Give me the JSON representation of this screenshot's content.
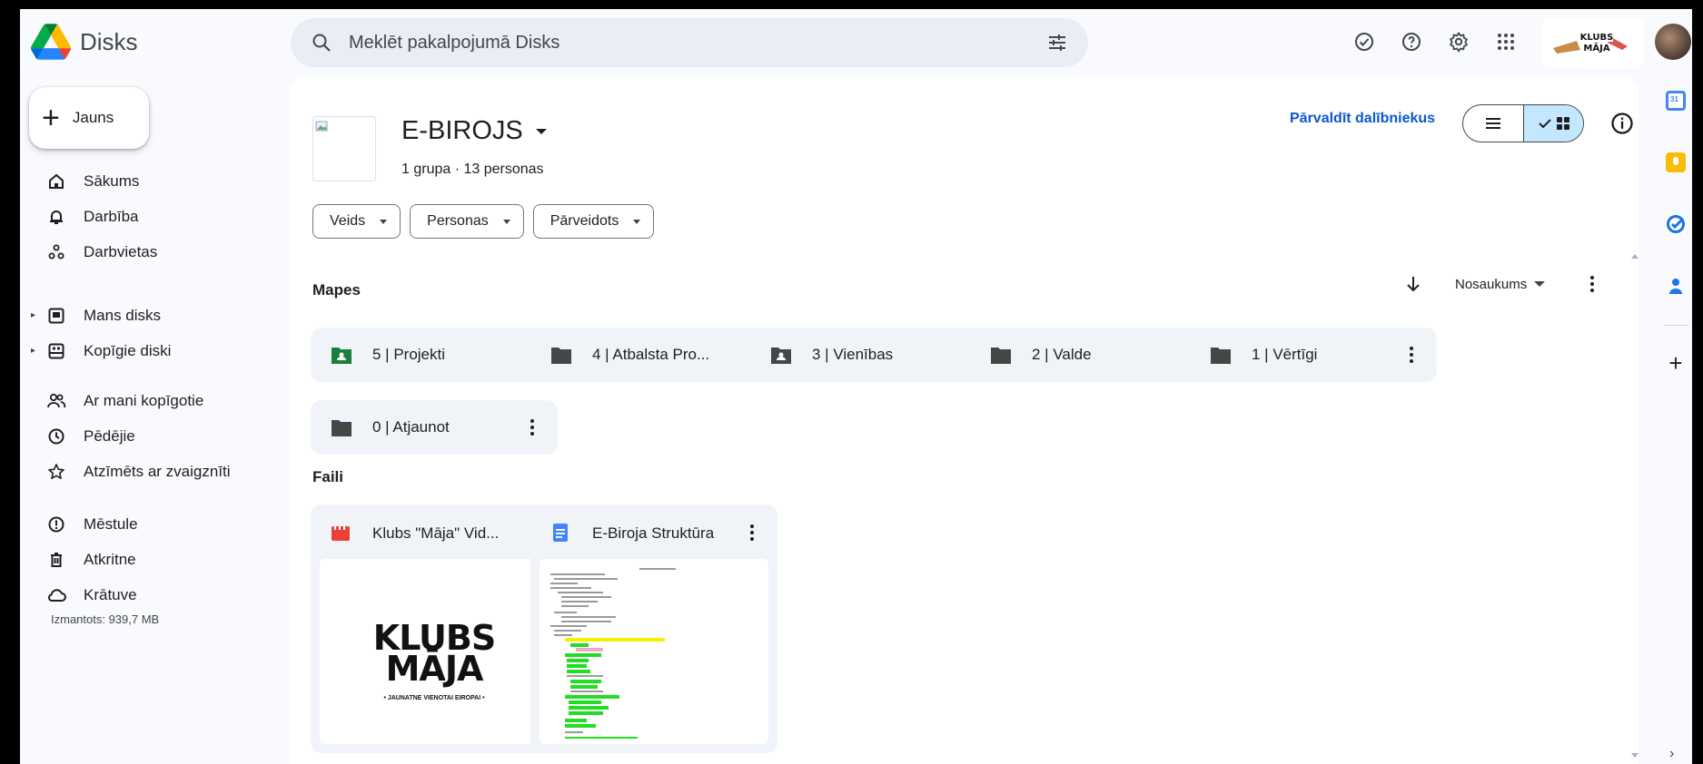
{
  "app": {
    "title": "Disks"
  },
  "search": {
    "placeholder": "Meklēt pakalpojumā Disks",
    "value": ""
  },
  "header": {
    "icons": [
      "offline-check-icon",
      "help-icon",
      "settings-icon",
      "apps-grid-icon"
    ],
    "brand_logo_text": "KLUBS MĀJA"
  },
  "sidebar": {
    "new_label": "Jauns",
    "items": [
      {
        "label": "Sākums",
        "icon": "home-icon"
      },
      {
        "label": "Darbība",
        "icon": "bell-icon"
      },
      {
        "label": "Darbvietas",
        "icon": "workspaces-icon"
      },
      {
        "label": "Mans disks",
        "icon": "my-drive-icon"
      },
      {
        "label": "Kopīgie diski",
        "icon": "shared-drives-icon"
      },
      {
        "label": "Ar mani kopīgotie",
        "icon": "people-icon"
      },
      {
        "label": "Pēdējie",
        "icon": "clock-icon"
      },
      {
        "label": "Atzīmēts ar zvaigznīti",
        "icon": "star-icon"
      },
      {
        "label": "Mēstule",
        "icon": "spam-icon"
      },
      {
        "label": "Atkritne",
        "icon": "trash-icon"
      },
      {
        "label": "Krātuve",
        "icon": "cloud-icon"
      }
    ],
    "storage_used": "Izmantots: 939,7 MB"
  },
  "main": {
    "group_title": "E-BIROJS",
    "group_subtitle": "1 grupa · 13 personas",
    "manage_members": "Pārvaldīt dalībniekus",
    "filters": [
      "Veids",
      "Personas",
      "Pārveidots"
    ],
    "folders_label": "Mapes",
    "files_label": "Faili",
    "sort_label": "Nosaukums",
    "folders": [
      {
        "name": "5 | Projekti",
        "icon": "shared-folder-icon",
        "color": "#188038"
      },
      {
        "name": "4 | Atbalsta Pro...",
        "icon": "folder-icon",
        "color": "#444746"
      },
      {
        "name": "3 | Vienības",
        "icon": "shared-folder-icon",
        "color": "#444746"
      },
      {
        "name": "2 | Valde",
        "icon": "folder-icon",
        "color": "#444746"
      },
      {
        "name": "1 | Vērtīgi",
        "icon": "folder-icon",
        "color": "#444746"
      },
      {
        "name": "0 | Atjaunot",
        "icon": "folder-icon",
        "color": "#444746"
      }
    ],
    "files": [
      {
        "name": "Klubs \"Māja\" Vid...",
        "icon": "video-icon",
        "color": "#ea4335",
        "thumb_line1": "KLUBS",
        "thumb_line2": "MĀJA",
        "thumb_caption": "• JAUNATNE VIENOTAI EIROPAI •"
      },
      {
        "name": "E-Biroja Struktūra",
        "icon": "docs-icon",
        "color": "#4285f4"
      }
    ]
  },
  "colors": {
    "accent": "#0b57d0",
    "selected_toggle": "#c2e7ff",
    "chip_bg": "#f0f4f9"
  }
}
